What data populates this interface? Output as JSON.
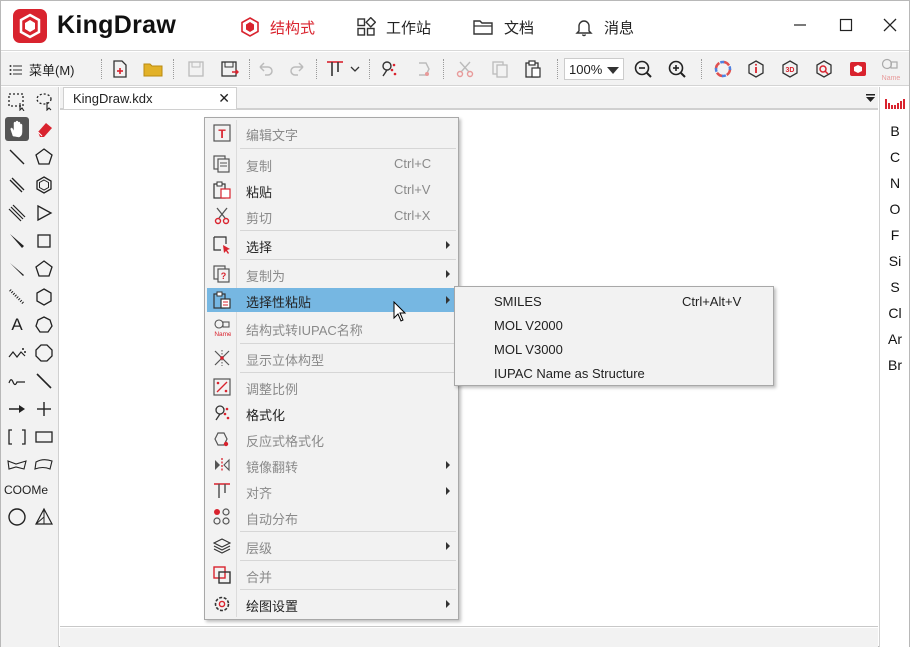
{
  "app": {
    "name": "KingDraw",
    "brand_color": "#d9232e"
  },
  "nav": {
    "tabs": [
      {
        "label": "结构式",
        "icon": "hexagon-icon",
        "active": true
      },
      {
        "label": "工作站",
        "icon": "grid-icon",
        "active": false
      },
      {
        "label": "文档",
        "icon": "folder-icon",
        "active": false
      },
      {
        "label": "消息",
        "icon": "bell-icon",
        "active": false
      }
    ]
  },
  "toolbar": {
    "menu_label": "菜单(M)",
    "zoom": "100%"
  },
  "document": {
    "tab_title": "KingDraw.kdx"
  },
  "right_panel": {
    "elements": [
      "B",
      "C",
      "N",
      "O",
      "F",
      "Si",
      "S",
      "Cl",
      "Ar",
      "Br"
    ]
  },
  "left_panel": {
    "text_tool": "A",
    "group_label": "COOMe"
  },
  "context_menu": {
    "items": [
      {
        "label": "编辑文字",
        "icon": "edit-text-icon",
        "disabled": true
      },
      {
        "label": "复制",
        "shortcut": "Ctrl+C",
        "icon": "copy-icon",
        "disabled": true
      },
      {
        "label": "粘贴",
        "shortcut": "Ctrl+V",
        "icon": "paste-icon",
        "disabled": false
      },
      {
        "label": "剪切",
        "shortcut": "Ctrl+X",
        "icon": "cut-icon",
        "disabled": true
      },
      {
        "label": "选择",
        "icon": "select-icon",
        "disabled": false,
        "submenu": true
      },
      {
        "label": "复制为",
        "icon": "copy-as-icon",
        "disabled": true,
        "submenu": true
      },
      {
        "label": "选择性粘贴",
        "icon": "paste-special-icon",
        "disabled": false,
        "submenu": true,
        "highlighted": true
      },
      {
        "label": "结构式转IUPAC名称",
        "icon": "structure-to-name-icon",
        "disabled": true
      },
      {
        "label": "显示立体构型",
        "icon": "stereo-icon",
        "disabled": true
      },
      {
        "label": "调整比例",
        "icon": "scale-icon",
        "disabled": true
      },
      {
        "label": "格式化",
        "icon": "format-icon",
        "disabled": false
      },
      {
        "label": "反应式格式化",
        "icon": "reaction-format-icon",
        "disabled": true
      },
      {
        "label": "镜像翻转",
        "icon": "mirror-icon",
        "disabled": true,
        "submenu": true
      },
      {
        "label": "对齐",
        "icon": "align-icon",
        "disabled": true,
        "submenu": true
      },
      {
        "label": "自动分布",
        "icon": "distribute-icon",
        "disabled": true
      },
      {
        "label": "层级",
        "icon": "layers-icon",
        "disabled": true,
        "submenu": true
      },
      {
        "label": "合并",
        "icon": "merge-icon",
        "disabled": true
      },
      {
        "label": "绘图设置",
        "icon": "settings-icon",
        "disabled": false,
        "submenu": true
      }
    ]
  },
  "paste_special_submenu": {
    "items": [
      {
        "label": "SMILES",
        "shortcut": "Ctrl+Alt+V"
      },
      {
        "label": "MOL V2000",
        "shortcut": ""
      },
      {
        "label": "MOL V3000",
        "shortcut": ""
      },
      {
        "label": "IUPAC Name as Structure",
        "shortcut": ""
      }
    ]
  }
}
